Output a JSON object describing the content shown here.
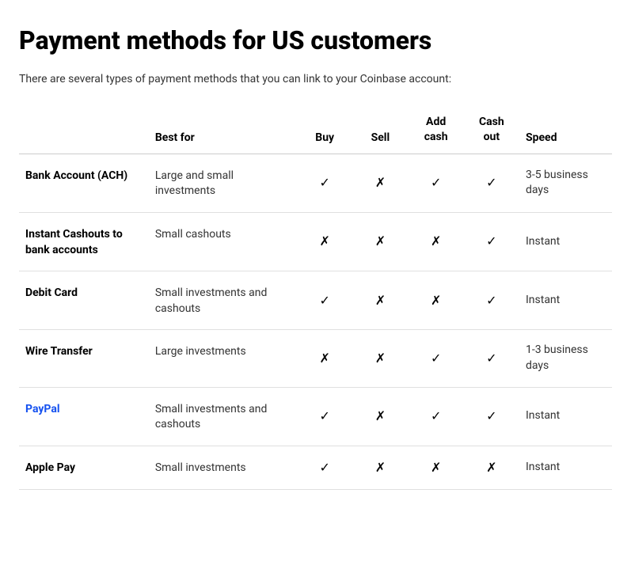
{
  "page": {
    "title": "Payment methods for US customers",
    "subtitle": "There are several types of payment methods that you can link to your Coinbase account:"
  },
  "table": {
    "headers": {
      "method": "",
      "best_for": "Best for",
      "buy": "Buy",
      "sell": "Sell",
      "add_cash": "Add cash",
      "cash_out": "Cash out",
      "speed": "Speed"
    },
    "rows": [
      {
        "method": "Bank Account (ACH)",
        "best_for": "Large and small investments",
        "buy": "✓",
        "sell": "✗",
        "add_cash": "✓",
        "cash_out": "✓",
        "speed": "3-5 business days",
        "is_link": false
      },
      {
        "method": "Instant Cashouts to bank accounts",
        "best_for": "Small cashouts",
        "buy": "✗",
        "sell": "✗",
        "add_cash": "✗",
        "cash_out": "✓",
        "speed": "Instant",
        "speed_blue": true,
        "is_link": false
      },
      {
        "method": "Debit Card",
        "best_for": "Small investments and cashouts",
        "buy": "✓",
        "sell": "✗",
        "add_cash": "✗",
        "cash_out": "✓",
        "speed": "Instant",
        "speed_blue": true,
        "is_link": false
      },
      {
        "method": "Wire Transfer",
        "best_for": "Large investments",
        "buy": "✗",
        "sell": "✗",
        "add_cash": "✓",
        "cash_out": "✓",
        "speed": "1-3 business days",
        "is_link": false
      },
      {
        "method": "PayPal",
        "best_for": "Small investments and cashouts",
        "buy": "✓",
        "sell": "✗",
        "add_cash": "✓",
        "cash_out": "✓",
        "speed": "Instant",
        "speed_blue": true,
        "is_link": true
      },
      {
        "method": "Apple Pay",
        "best_for": "Small investments",
        "buy": "✓",
        "sell": "✗",
        "add_cash": "✗",
        "cash_out": "✗",
        "speed": "Instant",
        "speed_blue": true,
        "is_link": false
      }
    ]
  }
}
